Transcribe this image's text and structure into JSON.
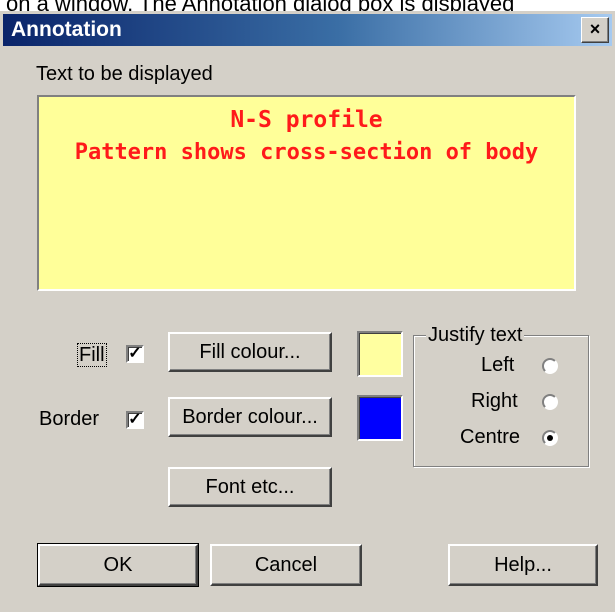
{
  "caption_text": "on a window. The Annotation dialog box is displayed",
  "dialog": {
    "title": "Annotation",
    "close_label": "×"
  },
  "text_label": "Text to be displayed",
  "preview": {
    "line1": "N-S profile",
    "line2": "Pattern shows cross-section of body",
    "background": "#ffff99",
    "text_color": "#ff1a1a"
  },
  "fill": {
    "label": "Fill",
    "checked": true,
    "button": "Fill colour...",
    "color": "#ffffa0"
  },
  "border": {
    "label": "Border",
    "checked": true,
    "button": "Border colour...",
    "color": "#0000ff"
  },
  "font_button": "Font etc...",
  "justify": {
    "title": "Justify text",
    "options": [
      {
        "label": "Left",
        "selected": false
      },
      {
        "label": "Right",
        "selected": false
      },
      {
        "label": "Centre",
        "selected": true
      }
    ]
  },
  "buttons": {
    "ok": "OK",
    "cancel": "Cancel",
    "help": "Help..."
  },
  "icons": {
    "close": "close-icon",
    "check": "checkmark-icon"
  }
}
